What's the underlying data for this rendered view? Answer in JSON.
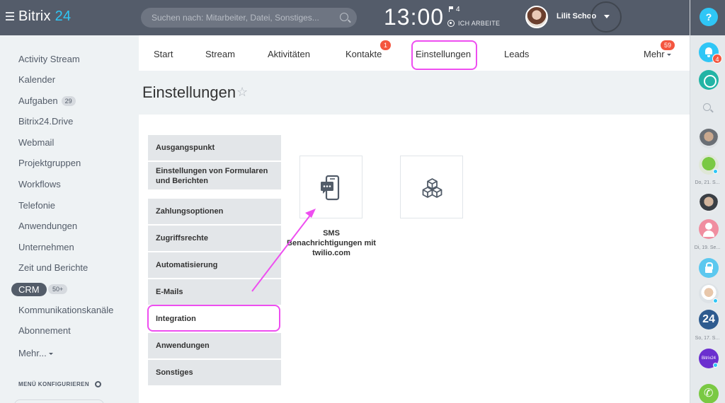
{
  "header": {
    "logo_main": "Bitrix",
    "logo_num": "24",
    "search_placeholder": "Suchen nach: Mitarbeiter, Datei, Sonstiges...",
    "clock": "13:00",
    "flag_count": "4",
    "work_status": "ICH ARBEITE",
    "user_name": "Lilit Schoo"
  },
  "sidebar": {
    "items": [
      {
        "label": "Activity Stream"
      },
      {
        "label": "Kalender"
      },
      {
        "label": "Aufgaben",
        "count": "29"
      },
      {
        "label": "Bitrix24.Drive"
      },
      {
        "label": "Webmail"
      },
      {
        "label": "Projektgruppen"
      },
      {
        "label": "Workflows"
      },
      {
        "label": "Telefonie"
      },
      {
        "label": "Anwendungen"
      },
      {
        "label": "Unternehmen"
      },
      {
        "label": "Zeit und Berichte"
      },
      {
        "label": "Kommunikationskanäle"
      },
      {
        "label": "Abonnement"
      },
      {
        "label": "Mehr..."
      }
    ],
    "crm": {
      "label": "CRM",
      "count": "50+"
    },
    "configure": "MENÜ KONFIGURIEREN"
  },
  "tabs": [
    {
      "label": "Start"
    },
    {
      "label": "Stream"
    },
    {
      "label": "Aktivitäten"
    },
    {
      "label": "Kontakte",
      "badge": "1"
    },
    {
      "label": "Einstellungen"
    },
    {
      "label": "Leads"
    },
    {
      "label": "Mehr",
      "badge": "59"
    }
  ],
  "page": {
    "title": "Einstellungen",
    "star": "☆"
  },
  "settings_nav": [
    {
      "label": "Ausgangspunkt"
    },
    {
      "label": "Einstellungen von Formularen und Berichten"
    },
    {
      "label": "Zahlungsoptionen"
    },
    {
      "label": "Zugriffsrechte"
    },
    {
      "label": "Automatisierung"
    },
    {
      "label": "E-Mails"
    },
    {
      "label": "Integration"
    },
    {
      "label": "Anwendungen"
    },
    {
      "label": "Sonstiges"
    }
  ],
  "tiles": [
    {
      "label": "SMS Benachrichtigungen mit twilio.com",
      "icon": "sms-phone-icon"
    },
    {
      "label": "",
      "icon": "cubes-icon"
    }
  ],
  "rightbar": {
    "help": "?",
    "bell_badge": "4",
    "dates": [
      "Do, 21. S...",
      "Di, 19. Se...",
      "So, 17. S..."
    ],
    "logo_badge": "24",
    "brand_badge": "Bitrix24"
  },
  "colors": {
    "topbar": "#545c6a",
    "accent": "#2fc6f6",
    "highlight": "#ee4ef0",
    "badge": "#f4563f"
  }
}
